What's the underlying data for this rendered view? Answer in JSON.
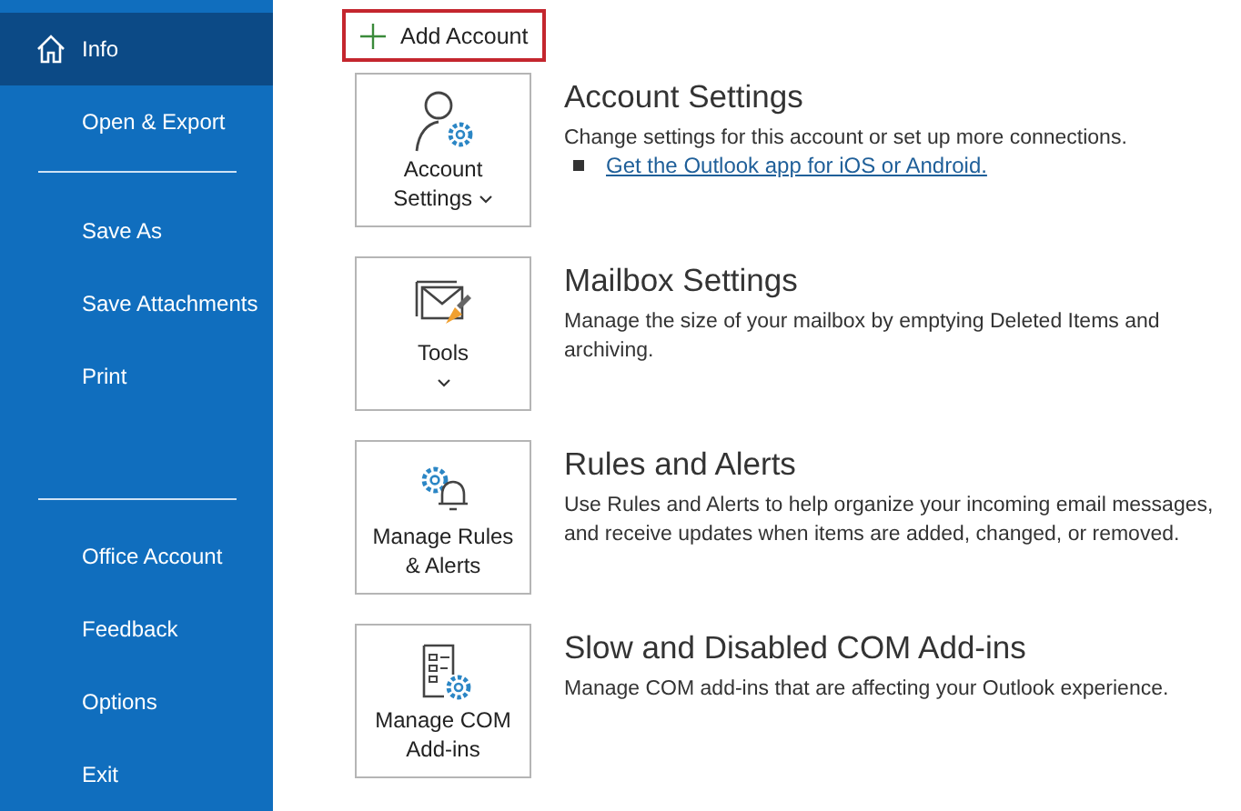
{
  "sidebar": {
    "groups": [
      [
        {
          "label": "Info",
          "selected": true
        },
        {
          "label": "Open & Export",
          "selected": false
        }
      ],
      [
        {
          "label": "Save As",
          "selected": false
        },
        {
          "label": "Save Attachments",
          "selected": false
        },
        {
          "label": "Print",
          "selected": false
        }
      ],
      [
        {
          "label": "Office Account",
          "selected": false
        },
        {
          "label": "Feedback",
          "selected": false
        },
        {
          "label": "Options",
          "selected": false
        },
        {
          "label": "Exit",
          "selected": false
        }
      ]
    ]
  },
  "add_account": {
    "label": "Add Account"
  },
  "sections": [
    {
      "kind": "account",
      "button": [
        "Account",
        "Settings"
      ],
      "dropdown": true,
      "title": "Account Settings",
      "description": "Change settings for this account or set up more connections.",
      "links": [
        "Get the Outlook app for iOS or Android."
      ]
    },
    {
      "kind": "tools",
      "button": [
        "Tools"
      ],
      "dropdown": true,
      "title": "Mailbox Settings",
      "description": "Manage the size of your mailbox by emptying Deleted Items and archiving."
    },
    {
      "kind": "rules",
      "button": [
        "Manage Rules",
        "& Alerts"
      ],
      "dropdown": false,
      "title": "Rules and Alerts",
      "description": "Use Rules and Alerts to help organize your incoming email messages, and receive updates when items are added, changed, or removed."
    },
    {
      "kind": "addins",
      "button": [
        "Manage COM",
        "Add-ins"
      ],
      "dropdown": false,
      "title": "Slow and Disabled COM Add-ins",
      "description": "Manage COM add-ins that are affecting your Outlook experience."
    }
  ]
}
